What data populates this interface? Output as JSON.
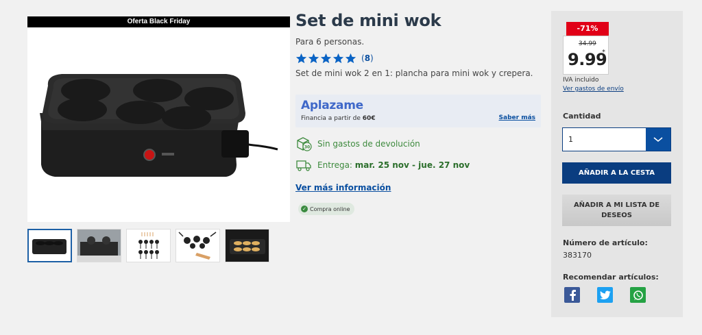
{
  "gallery": {
    "promo_banner": "Oferta Black Friday",
    "thumbnails": [
      "thumbnail-1",
      "thumbnail-2",
      "thumbnail-3",
      "thumbnail-4",
      "thumbnail-5"
    ],
    "selected_index": 0
  },
  "product": {
    "title": "Set de mini wok",
    "subtitle": "Para 6 personas.",
    "rating_stars": 5,
    "rating_count": "8",
    "description": "Set de mini wok 2 en 1: plancha para mini wok y crepera."
  },
  "aplazame": {
    "logo": "Aplazame",
    "financing_prefix": "Financia a partir de",
    "financing_amount": "60€",
    "link": "Saber más"
  },
  "features": {
    "returns": "Sin gastos de devolución",
    "returns_icon_number": "30",
    "delivery_prefix": "Entrega:",
    "delivery_dates": "mar. 25 nov - jue. 27 nov"
  },
  "links": {
    "more_info": "Ver más información"
  },
  "badge": {
    "online": "Compra online"
  },
  "buybox": {
    "discount": "-71%",
    "old_price": "34.99",
    "price": "9.99",
    "price_mark": "*",
    "iva": "IVA incluido",
    "shipping_link": "Ver gastos de envío",
    "quantity_label": "Cantidad",
    "quantity_value": "1",
    "add_to_cart": "AÑADIR A LA CESTA",
    "add_to_wishlist": "AÑADIR A MI LISTA DE DESEOS",
    "article_label": "Número de artículo:",
    "article_number": "383170",
    "recommend_label": "Recomendar artículos:"
  },
  "colors": {
    "accent_blue": "#0a3d80",
    "discount_red": "#e10017",
    "star_blue": "#0a63c4",
    "green": "#3d8a3d",
    "facebook": "#3b5998",
    "twitter": "#1da1f2",
    "whatsapp": "#25a244"
  }
}
